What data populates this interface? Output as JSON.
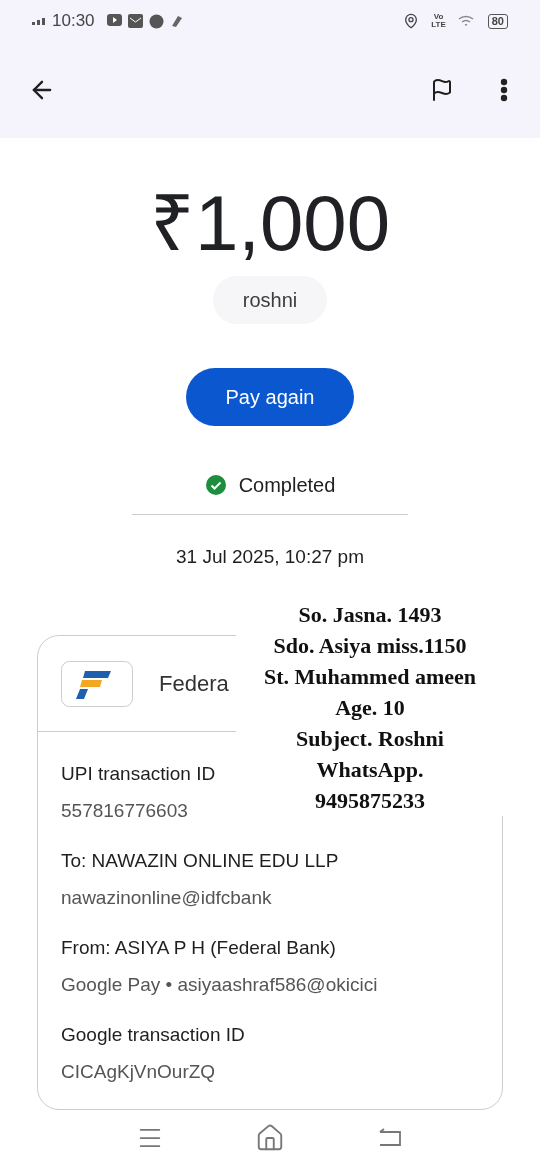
{
  "status_bar": {
    "time": "10:30",
    "network_lines": [
      "Vo",
      "LTE"
    ],
    "battery": "80"
  },
  "payment": {
    "amount": "₹1,000",
    "payee_chip": "roshni",
    "pay_again": "Pay again",
    "status": "Completed",
    "kind": "completed",
    "date": "31 Jul 2025, 10:27 pm"
  },
  "card": {
    "bank_name": "Federa",
    "details": [
      {
        "label": "UPI transaction ID",
        "value": "557816776603"
      },
      {
        "label": "To: NAWAZIN ONLINE EDU LLP",
        "value": "nawazinonline@idfcbank"
      },
      {
        "label": "From: ASIYA P H (Federal Bank)",
        "value": "Google Pay • asiyaashraf586@okicici"
      },
      {
        "label": "Google transaction ID",
        "value": "CICAgKjVnOurZQ"
      }
    ]
  },
  "note_overlay": [
    "So. Jasna. 1493",
    "Sdo. Asiya miss.1150",
    "St. Muhammed ameen",
    "Age. 10",
    "Subject. Roshni",
    "WhatsApp.",
    "9495875233"
  ]
}
